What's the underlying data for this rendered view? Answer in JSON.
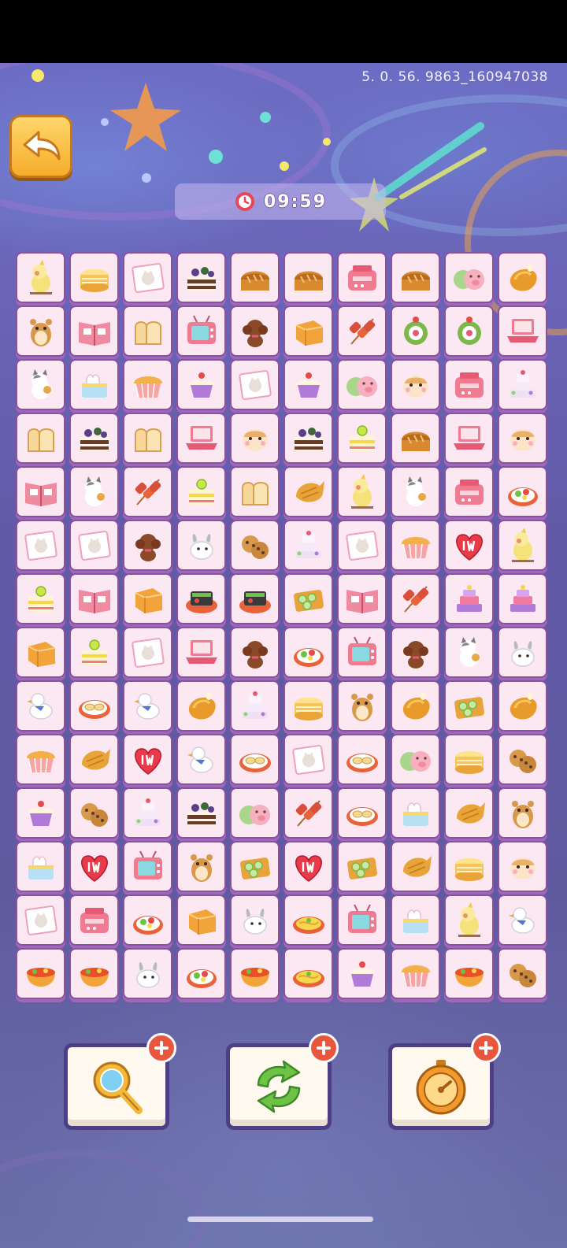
{
  "version": "5. 0. 56. 9863_160947038",
  "timer": {
    "icon": "clock-icon",
    "text": "09:59"
  },
  "back_button": {
    "icon": "back-arrow-icon"
  },
  "colors": {
    "tile_bg": "#fbe8f3",
    "tile_border": "#8a4fa6",
    "accent_orange": "#f6ad2b",
    "plus_red": "#e8563e"
  },
  "board": {
    "cols": 10,
    "rows": 14,
    "tiles": [
      [
        "cockatiel",
        "crepe-cake",
        "cat-postcard",
        "berry-cake",
        "bread-loaf",
        "bread-loaf",
        "pink-toaster",
        "bread-loaf",
        "pig-bun",
        "roast-chicken"
      ],
      [
        "hamster",
        "recipe-book",
        "toast",
        "pink-tv",
        "poodle",
        "cube-cake",
        "meat-skewers",
        "matcha-roll",
        "matcha-roll",
        "pink-laptop"
      ],
      [
        "calico-cat",
        "swan-cake",
        "muffin",
        "cupcake",
        "cat-postcard",
        "cupcake",
        "pig-bun",
        "hamster-face",
        "pink-toaster",
        "tier-cake"
      ],
      [
        "toast",
        "berry-cake",
        "toast",
        "pink-laptop",
        "hamster-face",
        "berry-cake",
        "lemon-cake",
        "bread-loaf",
        "pink-laptop",
        "hamster-face"
      ],
      [
        "recipe-book",
        "calico-cat",
        "meat-skewers",
        "lemon-cake",
        "toast",
        "taiyaki",
        "cockatiel",
        "calico-cat",
        "pink-toaster",
        "salad-plate"
      ],
      [
        "cat-postcard",
        "cat-postcard",
        "poodle",
        "bunny",
        "cookies",
        "tier-cake",
        "cat-postcard",
        "muffin",
        "heart-1w",
        "cockatiel"
      ],
      [
        "lemon-cake",
        "recipe-book",
        "cube-cake",
        "sushi-plate",
        "sushi-plate",
        "green-rolls",
        "recipe-book",
        "meat-skewers",
        "purple-cake",
        "purple-cake"
      ],
      [
        "cube-cake",
        "lemon-cake",
        "cat-postcard",
        "pink-laptop",
        "poodle",
        "salad-plate",
        "pink-tv",
        "poodle",
        "calico-cat",
        "bunny"
      ],
      [
        "duck",
        "dumpling-plate",
        "duck",
        "roast-chicken",
        "tier-cake",
        "crepe-cake",
        "hamster",
        "roast-chicken",
        "green-rolls",
        "roast-chicken"
      ],
      [
        "muffin",
        "taiyaki",
        "heart-1w",
        "duck",
        "dumpling-plate",
        "cat-postcard",
        "dumpling-plate",
        "pig-bun",
        "crepe-cake",
        "cookies"
      ],
      [
        "cupcake",
        "cookies",
        "tier-cake",
        "berry-cake",
        "pig-bun",
        "meat-skewers",
        "dumpling-plate",
        "swan-cake",
        "taiyaki",
        "hamster"
      ],
      [
        "swan-cake",
        "heart-1w",
        "pink-tv",
        "hamster",
        "green-rolls",
        "heart-1w",
        "green-rolls",
        "taiyaki",
        "crepe-cake",
        "hamster-face"
      ],
      [
        "cat-postcard",
        "pink-toaster",
        "salad-plate",
        "cube-cake",
        "bunny",
        "pasta-plate",
        "pink-tv",
        "swan-cake",
        "cockatiel",
        "duck"
      ],
      [
        "noodle-bowl",
        "noodle-bowl",
        "bunny",
        "salad-plate",
        "noodle-bowl",
        "pasta-plate",
        "cupcake",
        "muffin",
        "noodle-bowl",
        "cookies"
      ]
    ]
  },
  "tools": [
    {
      "name": "magnifier-tool",
      "icon": "magnifying-glass-icon",
      "plus": "+"
    },
    {
      "name": "shuffle-tool",
      "icon": "shuffle-arrows-icon",
      "plus": "+"
    },
    {
      "name": "time-tool",
      "icon": "stopwatch-icon",
      "plus": "+"
    }
  ]
}
